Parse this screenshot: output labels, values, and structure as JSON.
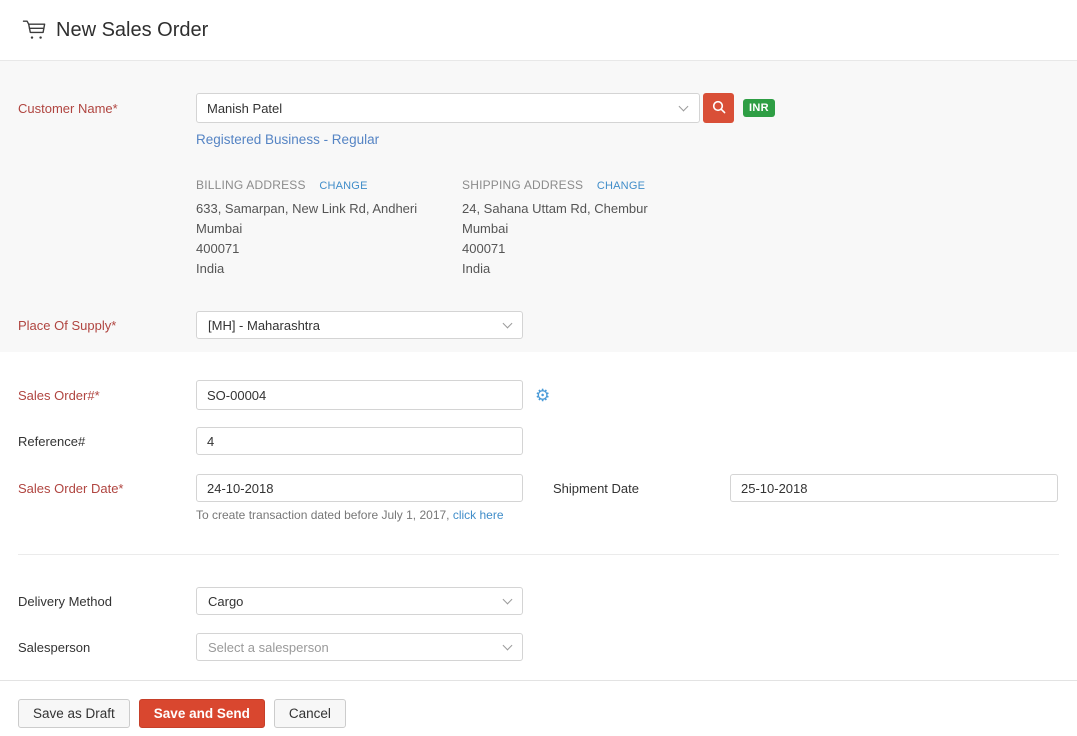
{
  "header": {
    "title": "New Sales Order"
  },
  "icons": {
    "cart": "cart-icon",
    "search": "search-icon",
    "gear_glyph": "⚙",
    "chevron": "chevron-down-icon"
  },
  "colors": {
    "accent_red": "#d9472f",
    "search_btn_red": "#d94f37",
    "badge_green": "#2e9e44",
    "required_label_red": "#b04540",
    "link_blue": "#408dc9"
  },
  "customer": {
    "label": "Customer Name*",
    "value": "Manish Patel",
    "currency_badge": "INR",
    "gst_treatment": "Registered Business - Regular"
  },
  "addresses": {
    "billing": {
      "heading": "BILLING ADDRESS",
      "change_label": "CHANGE",
      "lines": [
        "633, Samarpan, New Link Rd, Andheri",
        "Mumbai",
        "400071",
        "India"
      ]
    },
    "shipping": {
      "heading": "SHIPPING ADDRESS",
      "change_label": "CHANGE",
      "lines": [
        "24, Sahana Uttam Rd, Chembur",
        "Mumbai",
        "400071",
        "India"
      ]
    }
  },
  "fields": {
    "place_of_supply": {
      "label": "Place Of Supply*",
      "value": "[MH] - Maharashtra"
    },
    "sales_order_no": {
      "label": "Sales Order#*",
      "value": "SO-00004"
    },
    "reference": {
      "label": "Reference#",
      "value": "4"
    },
    "sales_order_date": {
      "label": "Sales Order Date*",
      "value": "24-10-2018",
      "helper_text": "To create transaction dated before July 1, 2017,",
      "helper_link": "click here"
    },
    "shipment_date": {
      "label": "Shipment Date",
      "value": "25-10-2018"
    },
    "delivery_method": {
      "label": "Delivery Method",
      "value": "Cargo"
    },
    "salesperson": {
      "label": "Salesperson",
      "placeholder": "Select a salesperson"
    }
  },
  "footer": {
    "save_draft": "Save as Draft",
    "save_send": "Save and Send",
    "cancel": "Cancel"
  }
}
